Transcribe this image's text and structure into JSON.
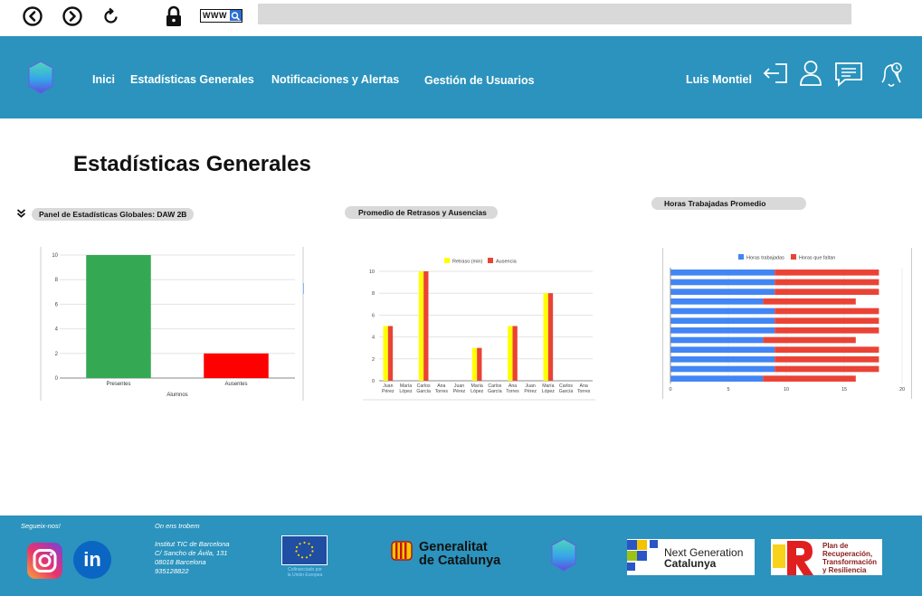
{
  "browser": {
    "back_icon": "chevron-left-circle",
    "forward_icon": "chevron-right-circle",
    "reload_icon": "reload",
    "lock_icon": "padlock",
    "www_label": "WWW"
  },
  "nav": {
    "links": [
      "Inici",
      "Estadísticas Generales",
      "Notificaciones y Alertas",
      "Gestión de Usuarios"
    ],
    "user_name": "Luis Montiel",
    "icons": [
      "logout-icon",
      "user-icon",
      "chat-icon",
      "bell-icon"
    ]
  },
  "page": {
    "title": "Estadísticas Generales",
    "panel_label": "Panel de Estadísticas Globales: DAW 2B",
    "chart1_label": "Promedio de Retrasos y Ausencias",
    "chart2_label": "Horas Trabajadas Promedio"
  },
  "colors": {
    "brand": "#2b93bd",
    "green": "#34a853",
    "red": "#ff0000",
    "yellow": "#ffff00",
    "blue": "#4285f4",
    "bar_red": "#ea4335"
  },
  "chart_data": [
    {
      "type": "bar",
      "categories": [
        "Presentes",
        "Ausentes"
      ],
      "values": [
        10,
        2
      ],
      "xlabel": "Alumnos",
      "ylim": [
        0,
        10
      ],
      "yticks": [
        "0",
        "2",
        "4",
        "6",
        "8",
        "10"
      ],
      "colors": [
        "#34a853",
        "#ff0000"
      ]
    },
    {
      "type": "bar",
      "categories": [
        [
          "Juan",
          "Pérez"
        ],
        [
          "María",
          "López"
        ],
        [
          "Carlos",
          "García"
        ],
        [
          "Ana",
          "Torres"
        ],
        [
          "Juan",
          "Pérez"
        ],
        [
          "María",
          "López"
        ],
        [
          "Carlos",
          "García"
        ],
        [
          "Ana",
          "Torres"
        ],
        [
          "Juan",
          "Pérez"
        ],
        [
          "María",
          "López"
        ],
        [
          "Carlos",
          "García"
        ],
        [
          "Ana",
          "Torres"
        ]
      ],
      "series": [
        {
          "name": "Retraso (min)",
          "color": "#ffff00",
          "values": [
            5,
            0,
            10,
            0,
            0,
            3,
            0,
            5,
            0,
            8,
            0,
            0
          ]
        },
        {
          "name": "Ausencia",
          "color": "#ea4335",
          "values": [
            5,
            0,
            10,
            0,
            0,
            3,
            0,
            5,
            0,
            8,
            0,
            0
          ]
        }
      ],
      "ylim": [
        0,
        10
      ],
      "yticks": [
        "0",
        "2",
        "4",
        "6",
        "8",
        "10"
      ],
      "legend": "top"
    },
    {
      "type": "bar",
      "orientation": "horizontal",
      "series": [
        {
          "name": "Horas trabajadas",
          "color": "#4285f4",
          "values": [
            9,
            9,
            9,
            8,
            9,
            9,
            9,
            8,
            9,
            9,
            9,
            8
          ]
        },
        {
          "name": "Horas que faltan",
          "color": "#ea4335",
          "values": [
            9,
            9,
            9,
            8,
            9,
            9,
            9,
            8,
            9,
            9,
            9,
            8
          ]
        }
      ],
      "xlim": [
        0,
        20
      ],
      "xticks": [
        "0",
        "5",
        "10",
        "15",
        "20"
      ],
      "legend": "top"
    }
  ],
  "footer": {
    "follow_label": "Segueix-nos!",
    "where_label": "On ens trobem",
    "address_lines": [
      "Institut TIC de Barcelona",
      "C/ Sancho de Ávila, 131",
      "08018 Barcelona",
      "935128822"
    ],
    "eu_caption_lines": [
      "Cofinanciado por",
      "la Unión Europea"
    ],
    "generalitat_lines": [
      "Generalitat",
      "de Catalunya"
    ],
    "nextgen_lines": [
      "Next Generation",
      "Catalunya"
    ],
    "plan_lines": [
      "Plan de",
      "Recuperación,",
      "Transformación",
      "y Resiliencia"
    ],
    "social": [
      "instagram-icon",
      "linkedin-icon"
    ],
    "linkedin_text": "in"
  }
}
